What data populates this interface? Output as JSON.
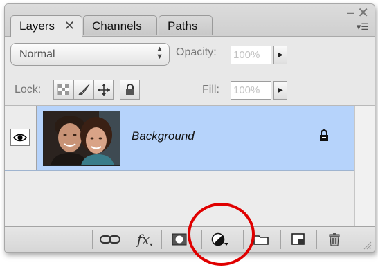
{
  "tabs": [
    {
      "label": "Layers",
      "active": true,
      "close": "✕"
    },
    {
      "label": "Channels",
      "active": false
    },
    {
      "label": "Paths",
      "active": false
    }
  ],
  "window": {
    "minimize": "–",
    "close": "✕",
    "menu": "▾☰"
  },
  "blend_mode": {
    "value": "Normal"
  },
  "opacity": {
    "label": "Opacity:",
    "value": "100%"
  },
  "lock": {
    "label": "Lock:"
  },
  "fill": {
    "label": "Fill:",
    "value": "100%"
  },
  "layers": [
    {
      "name": "Background",
      "visible": true,
      "selected": true,
      "locked": true
    }
  ],
  "colors": {
    "selected_row": "#b6d3fb",
    "highlight_circle": "#e00000"
  },
  "bottom_icons": [
    "link-icon",
    "fx-icon",
    "mask-icon",
    "adjustment-layer-icon",
    "group-folder-icon",
    "new-layer-icon",
    "trash-icon"
  ],
  "fx_label": "fx"
}
